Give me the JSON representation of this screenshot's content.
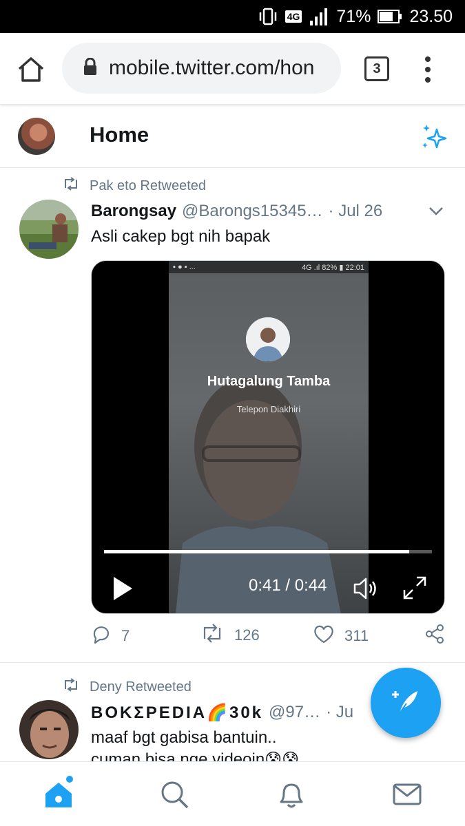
{
  "status_bar": {
    "network": "4G",
    "battery": "71%",
    "time": "23.50"
  },
  "browser": {
    "url": "mobile.twitter.com/hon",
    "tab_count": "3"
  },
  "header": {
    "title": "Home"
  },
  "tweets": [
    {
      "retweeted_by": "Pak eto Retweeted",
      "name": "Barongsay",
      "handle": "@Barongs15345…",
      "date": "· Jul 26",
      "text": "Asli cakep bgt nih bapak",
      "video": {
        "phone_status_left": "▪ ● ▪ ...",
        "phone_status_right": "4G .ıl 82% ▮ 22:01",
        "caller_name": "Hutagalung Tamba",
        "call_state": "Telepon Diakhiri",
        "time": "0:41 / 0:44",
        "progress": 0.93
      },
      "replies": "7",
      "retweets": "126",
      "likes": "311"
    },
    {
      "retweeted_by": "Deny Retweeted",
      "name": "BOKΣPEDIA🌈30k",
      "handle": "@97…",
      "date": "· Ju",
      "text_line1": "maaf bgt gabisa bantuin..",
      "text_line2": "cuman bisa nge videoin😰😰"
    }
  ],
  "colors": {
    "twitter_blue": "#1da1f2",
    "text_secondary": "#657786"
  }
}
